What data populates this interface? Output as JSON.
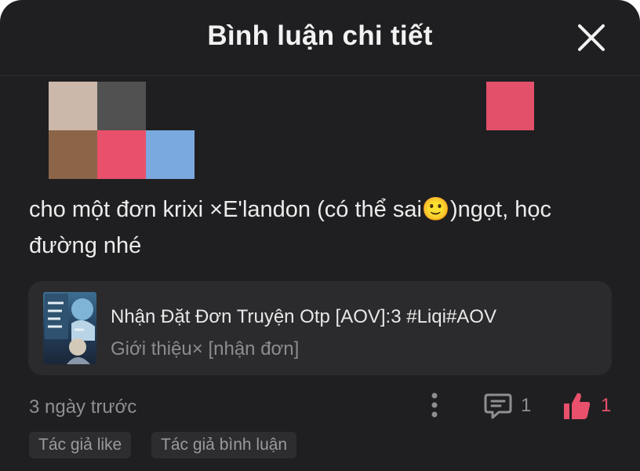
{
  "header": {
    "title": "Bình luận chi tiết",
    "close_icon": "close-icon"
  },
  "avatar": {
    "icon": "avatar-mosaic",
    "tile_colors": [
      "#cbb8aa",
      "#515151",
      "#1f1f21",
      "#8c6549",
      "#e9506b",
      "#7aa9df"
    ]
  },
  "sticker": {
    "icon": "sticker-image",
    "color": "#e2506a"
  },
  "comment": {
    "text": "cho một đơn krixi ×E'landon (có thể sai🙂)ngọt, học đường nhé"
  },
  "story_card": {
    "cover_icon": "book-cover-image",
    "title": "Nhận Đặt Đơn Truyện Otp [AOV]:3 #Liqi#AOV",
    "subtitle": "Giới thiệu× [nhận đơn]"
  },
  "footer": {
    "timestamp": "3 ngày trước",
    "more_icon": "more-vertical-icon",
    "reply_icon": "comment-icon",
    "reply_count": "1",
    "like_icon": "thumbs-up-icon",
    "like_count": "1"
  },
  "tags": [
    "Tác giả like",
    "Tác giả bình luận"
  ],
  "colors": {
    "background": "#1f1f21",
    "card": "#2b2b2d",
    "accent_like": "#e8506b",
    "text_primary": "#ececec",
    "text_muted": "#8f8f92"
  }
}
